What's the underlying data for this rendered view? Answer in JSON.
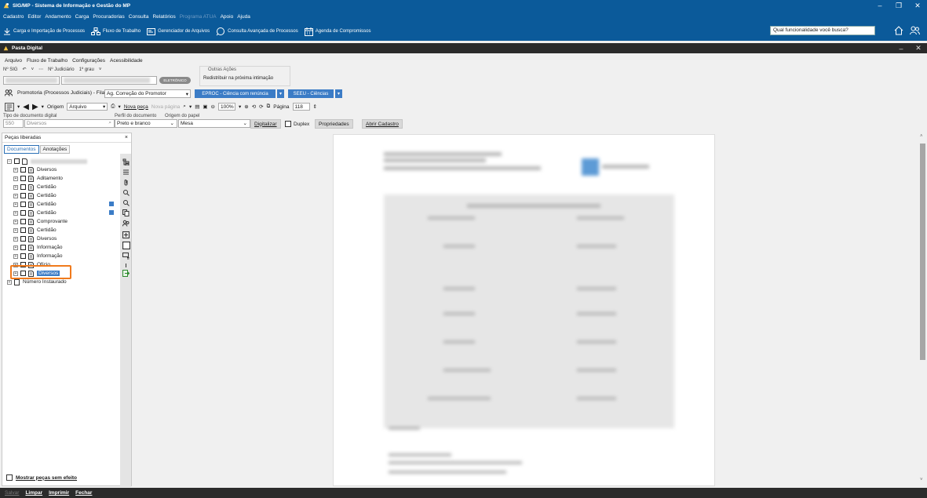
{
  "app": {
    "title": "SIG/MP - Sistema de Informação e Gestão do MP",
    "menu": [
      "Cadastro",
      "Editor",
      "Andamento",
      "Carga",
      "Procuradorias",
      "Consulta",
      "Relatórios",
      "Programa ATUA",
      "Apoio",
      "Ajuda"
    ],
    "toolbar": {
      "carga": "Carga e Importação de Processos",
      "fluxo": "Fluxo de Trabalho",
      "gerenciador": "Gerenciador de Arquivos",
      "consulta": "Consulta Avançada de Processos",
      "agenda": "Agenda de Compromissos"
    },
    "search_placeholder": "Qual funcionalidade você busca?",
    "colors": {
      "primary": "#0b5a9a",
      "dark": "#2b2b2b",
      "accent": "#3b7cc6",
      "highlight": "#f07a1c"
    }
  },
  "pasta": {
    "title": "Pasta Digital",
    "menu": [
      "Arquivo",
      "Fluxo de Trabalho",
      "Configurações",
      "Acessibilidade"
    ],
    "nsig_label": "Nº SIG",
    "njud_label": "Nº Judiciário",
    "grau": "1º grau",
    "eletronico": "ELETRÔNICO",
    "outras_acoes": "Outras Ações",
    "redistribuir": "Redistribuir na próxima intimação",
    "promotoria": "Promotoria (Processos Judiciais) - Fila:",
    "fila_value": "Ag. Correção do Promotor",
    "eproc_btn": "EPROC - Ciência com renúncia",
    "seeu_btn": "SEEU - Ciências",
    "origem_label": "Origem",
    "origem_value": "Arquivo",
    "nova_peca": "Nova peça",
    "nova_pagina": "Nova página",
    "zoom": "100%",
    "pagina_label": "Página",
    "pagina_value": "118",
    "tipo_label": "Tipo de documento digital",
    "tipo_code": "550",
    "tipo_value": "Diversos",
    "perfil_label": "Perfil do documento",
    "perfil_value": "Preto e branco",
    "origem_papel_label": "Origem do papel",
    "origem_papel_value": "Mesa",
    "digitalizar": "Digitalizar",
    "duplex": "Duplex",
    "propriedades": "Propriedades",
    "abrir_cadastro": "Abrir Cadastro"
  },
  "panel": {
    "title": "Peças liberadas",
    "tabs": [
      "Documentos",
      "Anotações"
    ],
    "items": [
      "Diversos",
      "Aditamento",
      "Certidão",
      "Certidão",
      "Certidão",
      "Certidão",
      "Comprovante",
      "Certidão",
      "Diversos",
      "Informação",
      "Informação",
      "Ofício",
      "Diversos"
    ],
    "selected_index": 12,
    "numero": "Número Instaurado",
    "mostrar": "Mostrar peças sem efeito"
  },
  "bottom": [
    "Salvar",
    "Limpar",
    "Imprimir",
    "Fechar"
  ]
}
